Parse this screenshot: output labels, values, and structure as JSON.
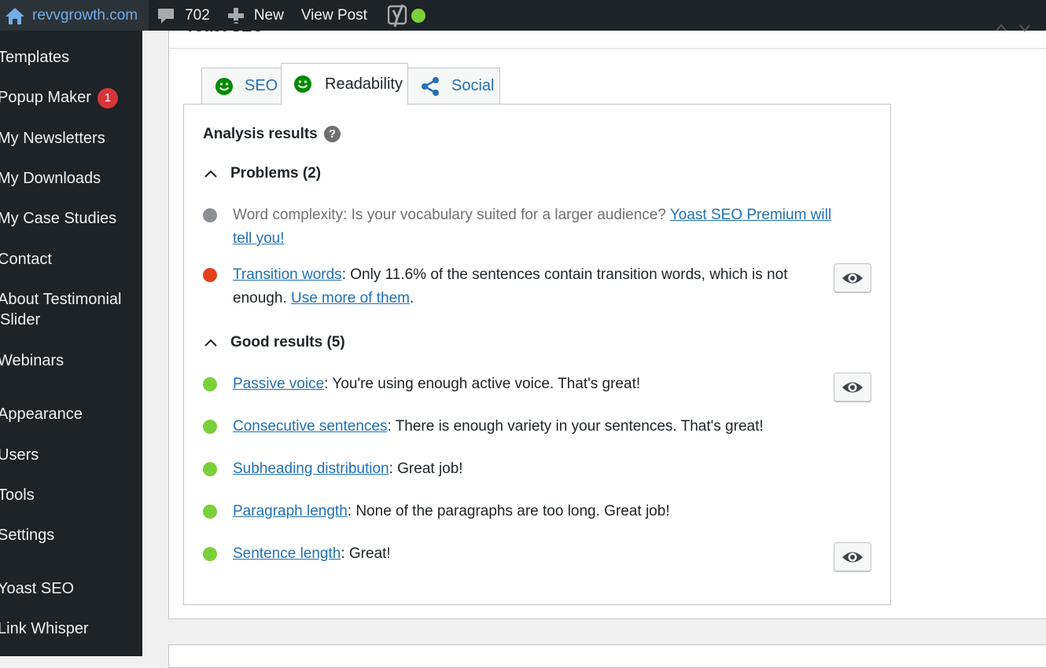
{
  "admin_bar": {
    "site_name": "revvgrowth.com",
    "comments_count": "702",
    "new_label": "New",
    "view_post_label": "View Post",
    "seo_status_color": "#7ad03a"
  },
  "sidebar": {
    "items": [
      {
        "label": "Templates"
      },
      {
        "label": "Popup Maker",
        "badge": "1"
      },
      {
        "label": "My Newsletters"
      },
      {
        "label": "My Downloads"
      },
      {
        "label": "My Case Studies"
      },
      {
        "label": "Contact"
      },
      {
        "label": "About Testimonial",
        "label_line2": "Slider"
      },
      {
        "label": "Webinars"
      },
      {
        "label": "Appearance"
      },
      {
        "label": "Users"
      },
      {
        "label": "Tools"
      },
      {
        "label": "Settings"
      },
      {
        "label": "Yoast SEO"
      },
      {
        "label": "Link Whisper"
      }
    ]
  },
  "postbox": {
    "title": "Yoast SEO"
  },
  "tabs": [
    {
      "label": "SEO",
      "icon": "smiley-icon",
      "icon_color": "#008a00"
    },
    {
      "label": "Readability",
      "icon": "smiley-icon",
      "icon_color": "#008a00",
      "active": true
    },
    {
      "label": "Social",
      "icon": "share-icon",
      "icon_color": "#2271b1"
    }
  ],
  "analysis": {
    "heading": "Analysis results",
    "help": "?",
    "problems": {
      "title": "Problems (2)",
      "items": [
        {
          "color": "#8c8f94",
          "text": "Word complexity: Is your vocabulary suited for a larger audience? ",
          "link": "Yoast SEO Premium will tell you!"
        },
        {
          "color": "#e2401c",
          "link": "Transition words",
          "text": ": Only 11.6% of the sentences contain transition words, which is not enough. ",
          "link2": "Use more of them",
          "after": "."
        }
      ]
    },
    "good": {
      "title": "Good results (5)",
      "items": [
        {
          "color": "#7ad03a",
          "link": "Passive voice",
          "text": ": You're using enough active voice. That's great!"
        },
        {
          "color": "#7ad03a",
          "link": "Consecutive sentences",
          "text": ": There is enough variety in your sentences. That's great!"
        },
        {
          "color": "#7ad03a",
          "link": "Subheading distribution",
          "text": ": Great job!"
        },
        {
          "color": "#7ad03a",
          "link": "Paragraph length",
          "text": ": None of the paragraphs are too long. Great job!"
        },
        {
          "color": "#7ad03a",
          "link": "Sentence length",
          "text": ": Great!"
        }
      ]
    }
  }
}
